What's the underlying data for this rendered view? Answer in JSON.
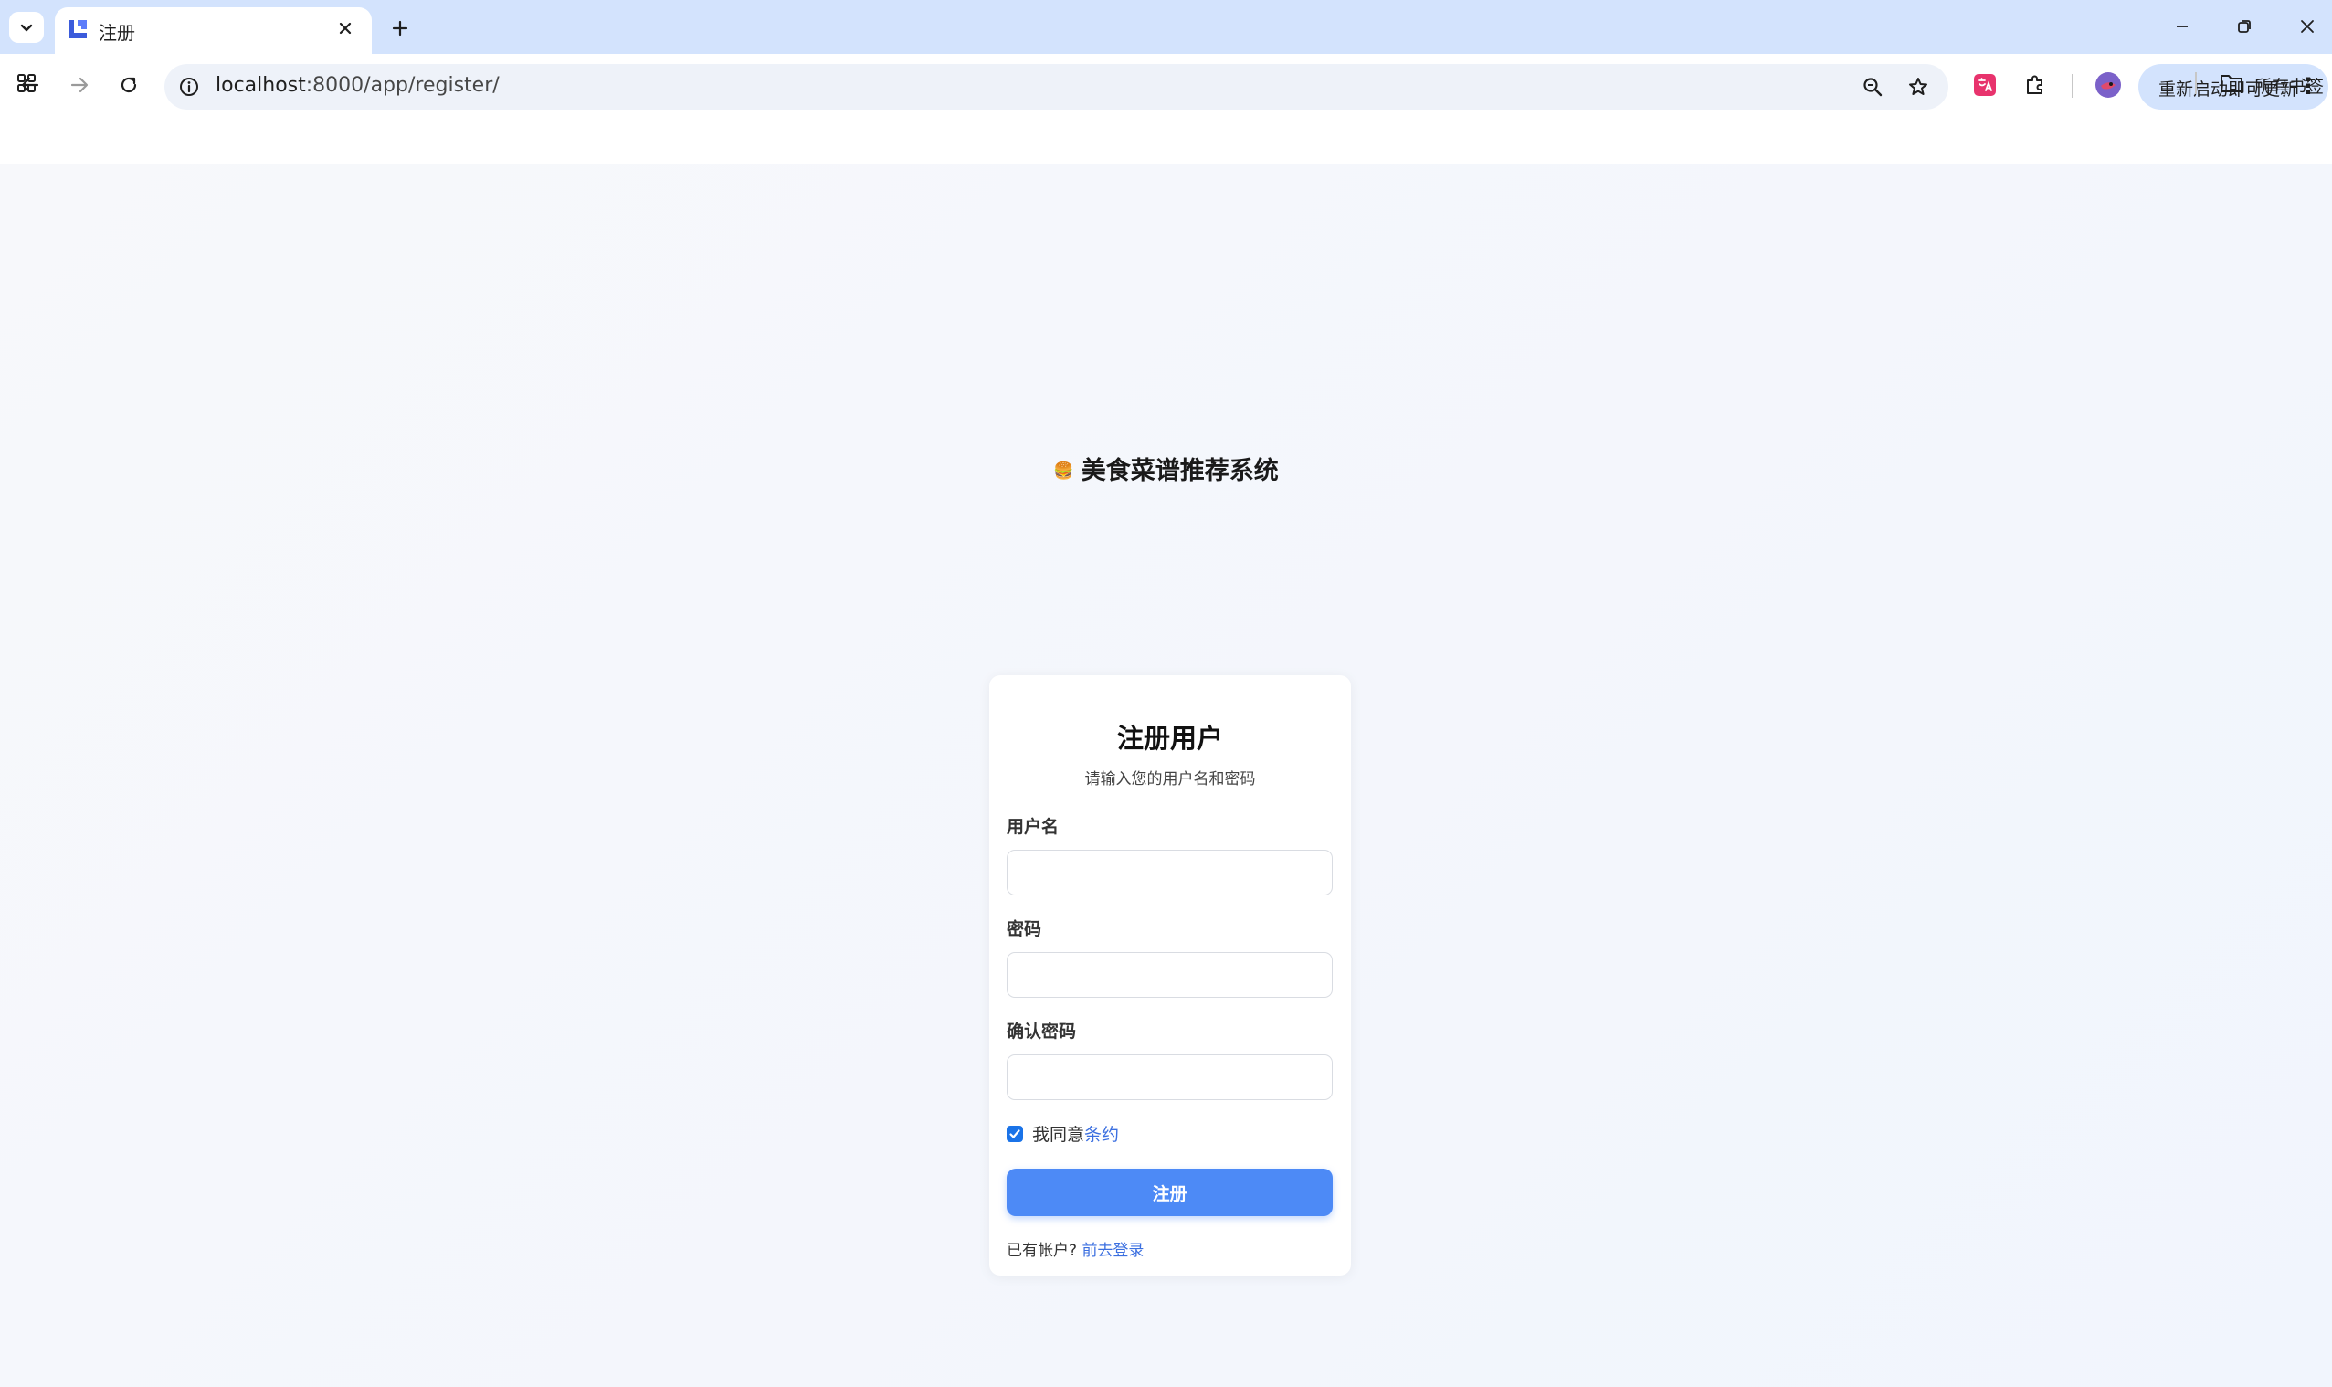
{
  "browser": {
    "tab_title": "注册",
    "url_host": "localhost",
    "url_path": ":8000/app/register/",
    "update_button_label": "重新启动即可更新",
    "bookmarks_label": "所有书签",
    "icons": {
      "tab_menu": "chevron-down-icon",
      "tab_close": "close-icon",
      "new_tab": "plus-icon",
      "back": "arrow-left-icon",
      "forward": "arrow-right-icon",
      "reload": "reload-icon",
      "site_info": "info-icon",
      "zoom": "zoom-icon",
      "bookmark": "star-icon",
      "extensions": "puzzle-icon",
      "apps": "grid-icon",
      "folder": "folder-icon"
    }
  },
  "app": {
    "emoji": "🍔",
    "title": "美食菜谱推荐系统"
  },
  "form": {
    "title": "注册用户",
    "subtitle": "请输入您的用户名和密码",
    "username_label": "用户名",
    "username_value": "",
    "password_label": "密码",
    "password_value": "",
    "confirm_label": "确认密码",
    "confirm_value": "",
    "agree_checked": true,
    "agree_text": "我同意",
    "agree_link": "条约",
    "submit_label": "注册",
    "login_prompt": "已有帐户?",
    "login_link": "前去登录"
  },
  "colors": {
    "accent": "#4d8af6",
    "link": "#3b6fe0",
    "tabstrip": "#d3e3fd"
  }
}
